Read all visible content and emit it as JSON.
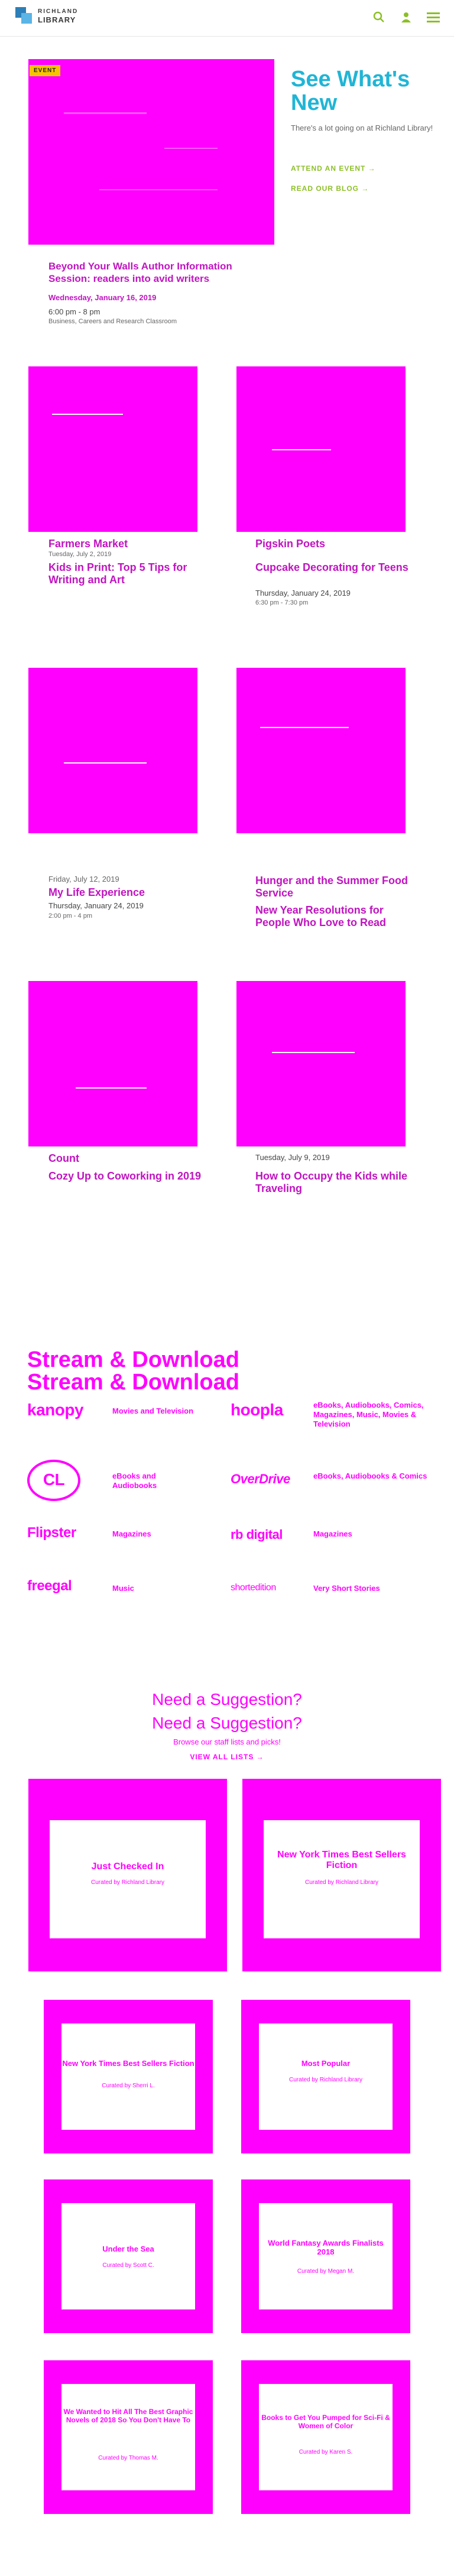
{
  "header": {
    "logo_line1": "RICHLAND",
    "logo_line2": "LIBRARY",
    "icons": [
      "search-icon",
      "account-icon",
      "menu-icon"
    ],
    "accent": "#8cbf26"
  },
  "featured": {
    "badge": "EVENT",
    "title": "Beyond Your Walls Author Information Session: readers into avid writers",
    "date": "Wednesday, January 16, 2019",
    "time": "6:00 pm - 8 pm",
    "location": "Business, Careers and Research Classroom"
  },
  "whats_new": {
    "title": "See What's New",
    "text": "There's a lot going on at Richland Library!",
    "link1": "ATTEND AN EVENT →",
    "link2": "READ OUR BLOG →"
  },
  "cards": [
    {
      "title": "Farmers Market",
      "sub": "Kids in Print: Top 5 Tips for Writing and Art",
      "date": "Tuesday, July 2, 2019",
      "loc": ""
    },
    {
      "title": "Pigskin Poets",
      "sub": "Cupcake Decorating for Teens",
      "date": "Thursday, January 24, 2019",
      "loc": "6:30 pm - 7:30 pm"
    },
    {
      "title": "My Life Experience",
      "sub": "Thursday, January 24, 2019",
      "date": "Friday, July 12, 2019",
      "loc": "2:00 pm - 4 pm"
    },
    {
      "title": "Hunger and the Summer Food Service",
      "sub": "New Year Resolutions for People Who Love to Read",
      "date": "",
      "loc": ""
    },
    {
      "title": "Count",
      "sub": "Cozy Up to Coworking in 2019",
      "date": "",
      "loc": ""
    },
    {
      "title": "How to Occupy the Kids while Traveling",
      "sub": "Tuesday, July 9, 2019",
      "date": "",
      "loc": ""
    }
  ],
  "stream": {
    "title": "Stream & Download",
    "rows": [
      {
        "logo_l": "kanopy",
        "cat_l": "Movies and Television",
        "logo_r": "hoopla",
        "cat_r": "eBooks, Audiobooks, Comics, Magazines, Music, Movies & Television"
      },
      {
        "logo_l": "CL",
        "cat_l": "eBooks and Audiobooks",
        "logo_r": "OverDrive",
        "cat_r": "eBooks, Audiobooks & Comics"
      },
      {
        "logo_l": "Flipster",
        "cat_l": "Magazines",
        "logo_r": "rb digital",
        "cat_r": "Magazines"
      },
      {
        "logo_l": "freegal",
        "cat_l": "Music",
        "logo_r": "shortedition",
        "cat_r": "Very Short Stories"
      }
    ]
  },
  "suggestion": {
    "title": "Need a Suggestion?",
    "text": "Browse our staff lists and picks!",
    "link": "VIEW ALL LISTS →"
  },
  "lists": [
    {
      "title": "Just Checked In",
      "sub": "Curated by Richland Library"
    },
    {
      "title": "New York Times Best Sellers Fiction",
      "sub": "Curated by Richland Library"
    },
    {
      "title": "New York Times Best Sellers Fiction",
      "sub": "Curated by Sherri L."
    },
    {
      "title": "Most Popular",
      "sub": "Curated by Richland Library"
    },
    {
      "title": "Under the Sea",
      "sub": "Curated by Scott C."
    },
    {
      "title": "World Fantasy Awards Finalists 2018",
      "sub": "Curated by Megan M."
    },
    {
      "title": "We Wanted to Hit All The Best Graphic Novels of 2018 So You Don't Have To",
      "sub": "Curated by Thomas M."
    },
    {
      "title": "Books to Get You Pumped for Sci-Fi & Women of Color",
      "sub": "Curated by Karen S."
    }
  ]
}
